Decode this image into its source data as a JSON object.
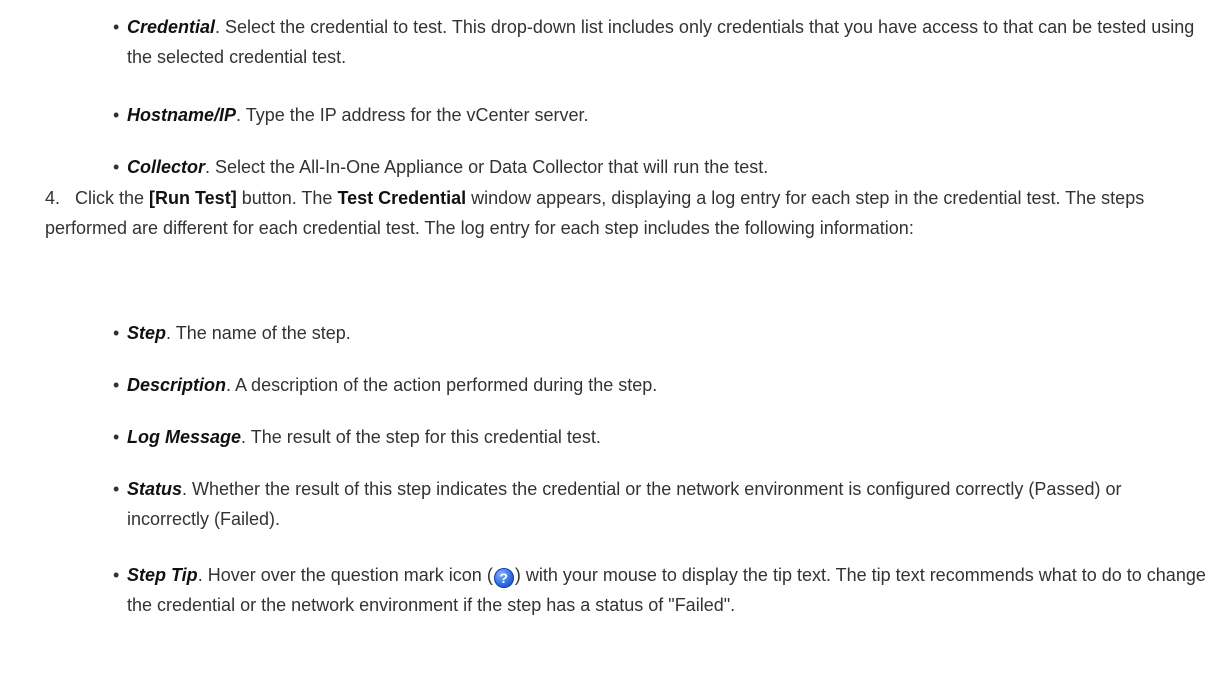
{
  "list1": {
    "credential": {
      "term": "Credential",
      "text": ". Select the credential to test. This drop-down list includes only credentials that you have access to that can be tested using the selected credential test."
    },
    "hostname": {
      "term": "Hostname/IP",
      "text": ". Type the IP address for the vCenter server."
    },
    "collector": {
      "term": "Collector",
      "text": ". Select the All-In-One Appliance or Data Collector that will run the test."
    }
  },
  "step4": {
    "number": "4.",
    "part1": "Click the ",
    "button_label": "[Run Test]",
    "part2": " button. The ",
    "window_name": "Test Credential",
    "part3": " window appears, displaying a log entry for each step in the credential test. The steps performed are different for each credential test. The log entry for each step includes the following information:"
  },
  "list2": {
    "step": {
      "term": "Step",
      "text": ". The name of the step."
    },
    "description": {
      "term": "Description",
      "text": ". A description of the action performed during the step."
    },
    "logmsg": {
      "term": "Log Message",
      "text": ". The result of the step for this credential test."
    },
    "status": {
      "term": "Status",
      "text": ". Whether the result of this step indicates the credential or the network environment is configured correctly (Passed) or incorrectly (Failed)."
    },
    "steptip": {
      "term": "Step Tip",
      "text_before": ". Hover over the question mark icon (",
      "icon": "question-mark-icon",
      "text_after": ") with your mouse to display the tip text. The tip text recommends what to do to change the credential or the network environment if the step has a status of \"Failed\"."
    }
  },
  "colors": {
    "text": "#333333",
    "icon_blue": "#2f6de0"
  }
}
